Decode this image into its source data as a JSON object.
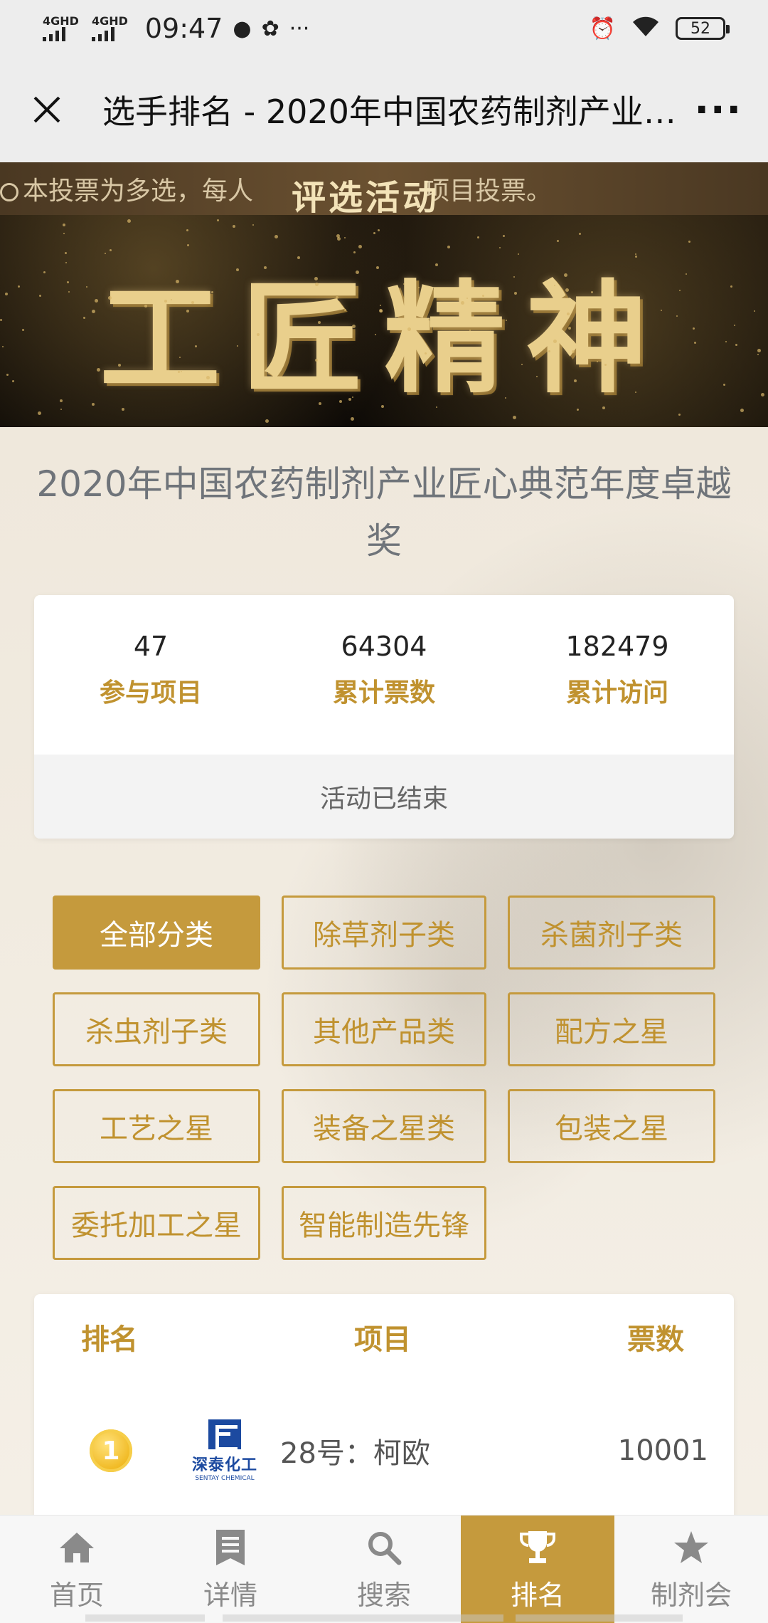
{
  "status_bar": {
    "net1": "4GHD",
    "net2": "4GHD",
    "time": "09:47",
    "battery": "52"
  },
  "title_bar": {
    "title": "选手排名 - 2020年中国农药制剂产业匠心典范年度卓越奖",
    "more": "···"
  },
  "banner": {
    "marquee": "本投票为多选，每人",
    "marquee_tail": "项目投票。",
    "subtitle": "评选活动",
    "main_title": "工匠精神"
  },
  "event": {
    "title": "2020年中国农药制剂产业匠心典范年度卓越奖"
  },
  "stats": [
    {
      "value": "47",
      "label": "参与项目"
    },
    {
      "value": "64304",
      "label": "累计票数"
    },
    {
      "value": "182479",
      "label": "累计访问"
    }
  ],
  "status_text": "活动已结束",
  "categories": [
    {
      "label": "全部分类",
      "active": true
    },
    {
      "label": "除草剂子类"
    },
    {
      "label": "杀菌剂子类"
    },
    {
      "label": "杀虫剂子类"
    },
    {
      "label": "其他产品类"
    },
    {
      "label": "配方之星"
    },
    {
      "label": "工艺之星"
    },
    {
      "label": "装备之星类"
    },
    {
      "label": "包装之星"
    },
    {
      "label": "委托加工之星"
    },
    {
      "label": "智能制造先锋"
    }
  ],
  "ranking": {
    "headers": {
      "rank": "排名",
      "item": "项目",
      "votes": "票数"
    },
    "rows": [
      {
        "rank": "1",
        "logo_cn": "深泰化工",
        "logo_en": "SENTAY CHEMICAL",
        "name": "28号：柯欧",
        "votes": "10001"
      }
    ]
  },
  "nav": [
    {
      "label": "首页",
      "icon": "home-icon"
    },
    {
      "label": "详情",
      "icon": "document-icon"
    },
    {
      "label": "搜索",
      "icon": "search-icon"
    },
    {
      "label": "排名",
      "icon": "trophy-icon",
      "active": true
    },
    {
      "label": "制剂会",
      "icon": "star-icon"
    }
  ],
  "colors": {
    "accent": "#c59a3d",
    "label_gold": "#c0922f",
    "background": "#f1ece2"
  }
}
